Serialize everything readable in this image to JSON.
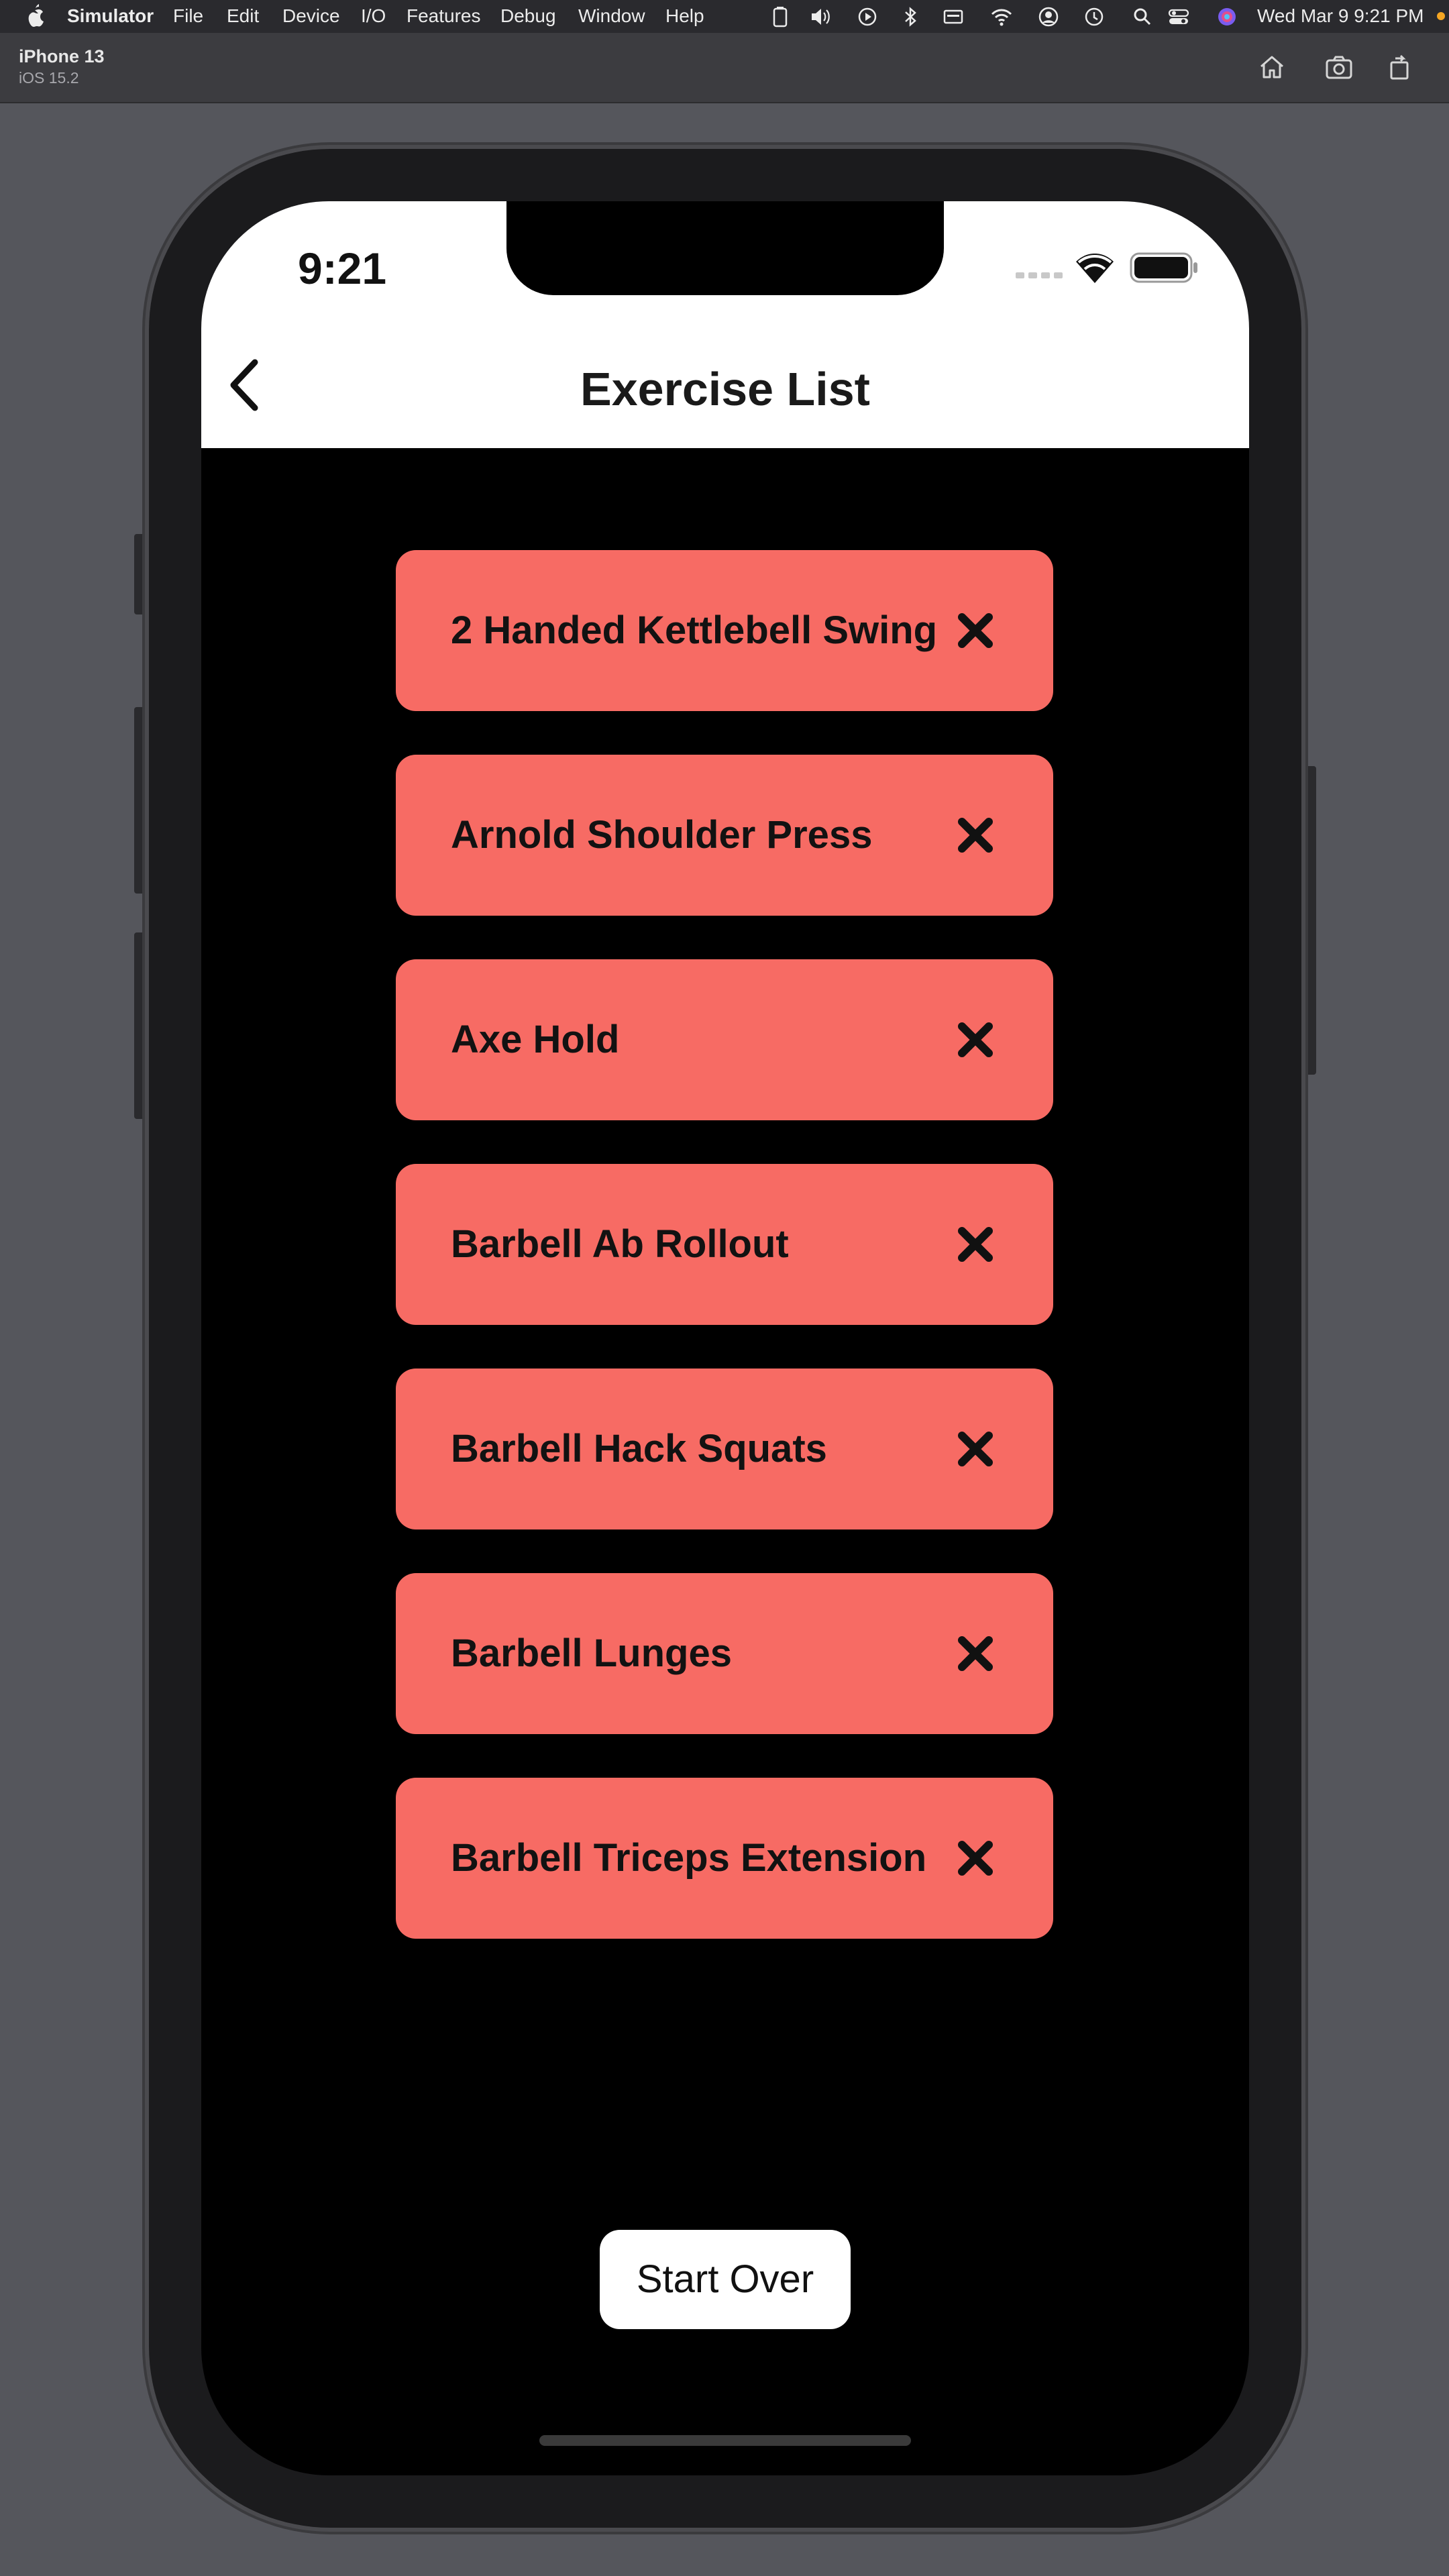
{
  "menubar": {
    "app_name": "Simulator",
    "items": [
      "File",
      "Edit",
      "Device",
      "I/O",
      "Features",
      "Debug",
      "Window",
      "Help"
    ],
    "clock": "Wed Mar 9  9:21 PM"
  },
  "toolbar": {
    "device_name": "iPhone 13",
    "os_version": "iOS 15.2"
  },
  "status_bar": {
    "time": "9:21"
  },
  "nav": {
    "title": "Exercise List"
  },
  "exercises": [
    "2 Handed Kettlebell Swing",
    "Arnold Shoulder Press",
    "Axe Hold",
    "Barbell Ab Rollout",
    "Barbell Hack Squats",
    "Barbell Lunges",
    "Barbell Triceps Extension"
  ],
  "buttons": {
    "start_over": "Start Over"
  },
  "colors": {
    "card": "#f76b64",
    "screen_bg": "#000000",
    "nav_bg": "#ffffff"
  }
}
